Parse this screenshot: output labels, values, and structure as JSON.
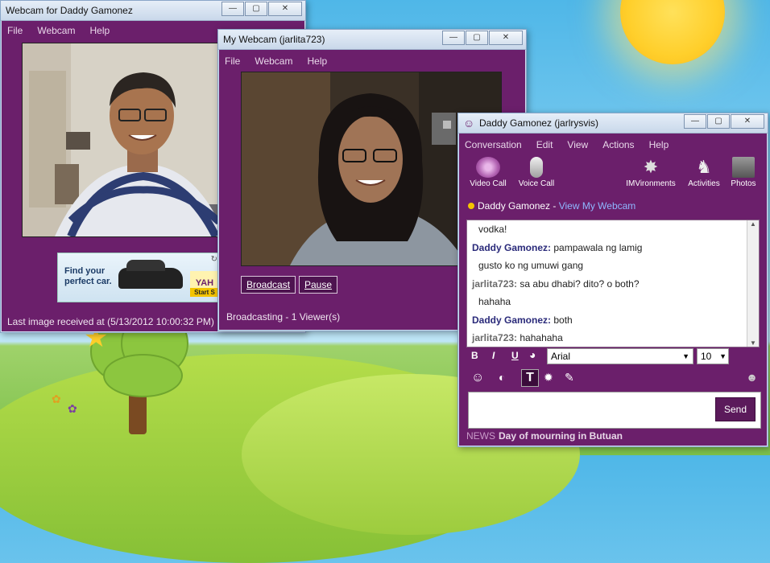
{
  "webcam_left": {
    "title": "Webcam for Daddy Gamonez",
    "menu": [
      "File",
      "Webcam",
      "Help"
    ],
    "ad_line1": "Find your",
    "ad_line2": "perfect car.",
    "ad_brand": "YAH",
    "ad_cta": "Start S",
    "status": "Last image received at (5/13/2012 10:00:32 PM)"
  },
  "my_webcam": {
    "title": "My Webcam (jarlita723)",
    "menu": [
      "File",
      "Webcam",
      "Help"
    ],
    "broadcast_label": "Broadcast",
    "pause_label": "Pause",
    "status": "Broadcasting - 1 Viewer(s)"
  },
  "conversation": {
    "title": "Daddy Gamonez (jarlrysvis)",
    "menu": [
      "Conversation",
      "Edit",
      "View",
      "Actions",
      "Help"
    ],
    "toolbar": {
      "video_call": "Video Call",
      "voice_call": "Voice Call",
      "imvironments": "IMVironments",
      "activities": "Activities",
      "photos": "Photos"
    },
    "contact_name": "Daddy Gamonez",
    "contact_sep": " - ",
    "contact_link": "View My Webcam",
    "messages": [
      {
        "who": "",
        "text": "vodka!",
        "color": "#222222"
      },
      {
        "who": "Daddy Gamonez:",
        "text": " pampawala ng lamig",
        "color": "#2a2a7a"
      },
      {
        "who": "",
        "text": "gusto ko ng umuwi gang",
        "color": "#222222"
      },
      {
        "who": "jarlita723:",
        "text": " sa abu dhabi? dito? o both?",
        "color": "#6a6a6a"
      },
      {
        "who": "",
        "text": "hahaha",
        "color": "#222222"
      },
      {
        "who": "Daddy Gamonez:",
        "text": " both",
        "color": "#2a2a7a"
      },
      {
        "who": "jarlita723:",
        "text": " hahahaha",
        "color": "#6a6a6a"
      }
    ],
    "font_name": "Arial",
    "font_size": "10",
    "send_label": "Send",
    "news_tag": "NEWS",
    "news_text": "Day of mourning in Butuan"
  }
}
